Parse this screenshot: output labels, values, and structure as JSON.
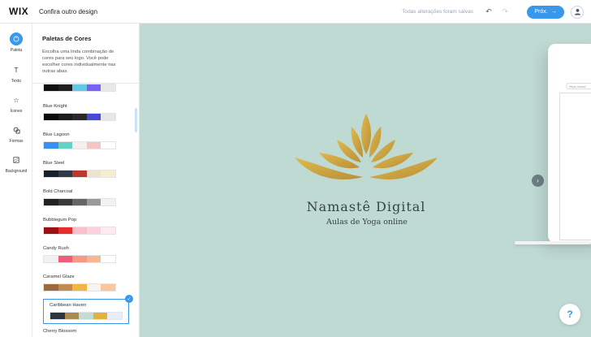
{
  "app": {
    "logo": "WIX",
    "title": "Confira outro design",
    "saved_status": "Todas alterações foram salvas",
    "next_label": "Próx."
  },
  "rail": {
    "items": [
      {
        "label": "Paleta",
        "icon": "palette-icon",
        "active": true
      },
      {
        "label": "Texto",
        "icon": "text-icon",
        "active": false
      },
      {
        "label": "Ícones",
        "icon": "star-icon",
        "active": false
      },
      {
        "label": "Formas",
        "icon": "shapes-icon",
        "active": false
      },
      {
        "label": "Background",
        "icon": "background-icon",
        "active": false
      }
    ]
  },
  "panel": {
    "title": "Paletas de Cores",
    "description": "Escolha uma linda combinação de cores para seu logo. Você pode escolher cores individualmente nas outras abas."
  },
  "palettes": [
    {
      "name": "",
      "colors": [
        "#111111",
        "#1f1f1f",
        "#63c7e6",
        "#7a61f2",
        "#e8e8e8"
      ]
    },
    {
      "name": "Blue Knight",
      "colors": [
        "#0b0b0b",
        "#1c1c1c",
        "#2a2a2a",
        "#4848d8",
        "#e6e6e6"
      ]
    },
    {
      "name": "Blue Lagoon",
      "colors": [
        "#3b8ff0",
        "#63d1c6",
        "#f6eeee",
        "#f5c5c5",
        "#ffffff"
      ]
    },
    {
      "name": "Blue Steel",
      "colors": [
        "#16212c",
        "#2d3a47",
        "#b8392e",
        "#ede3d3",
        "#f7eed0"
      ]
    },
    {
      "name": "Bold Charcoal",
      "colors": [
        "#222222",
        "#3a3a3a",
        "#666666",
        "#9a9a9a",
        "#f2f2f2"
      ]
    },
    {
      "name": "Bubblegum Pop",
      "colors": [
        "#9b1015",
        "#e52b2b",
        "#f7c0cb",
        "#fbd2dc",
        "#fde9ef"
      ]
    },
    {
      "name": "Candy Rush",
      "colors": [
        "#f1f1f1",
        "#ee5d79",
        "#f59a87",
        "#f7b792",
        "#ffffff"
      ]
    },
    {
      "name": "Caramel Glaze",
      "colors": [
        "#9c6a3d",
        "#c48a56",
        "#f3b444",
        "#fbf4ec",
        "#f8c79d"
      ]
    },
    {
      "name": "Caribbean Haven",
      "colors": [
        "#2e3440",
        "#a98b4f",
        "#c5dcd5",
        "#e2b33c",
        "#e7eef8"
      ],
      "selected": true
    },
    {
      "name": "Cherry Blossom",
      "colors": []
    }
  ],
  "canvas": {
    "background": "#bfd9d3",
    "brand_title": "Namastê Digital",
    "brand_subtitle": "Aulas de Yoga online",
    "device_url": "https://www",
    "help_label": "?"
  },
  "colors": {
    "accent": "#3899ec",
    "logo_gold": "#d4a73c"
  }
}
